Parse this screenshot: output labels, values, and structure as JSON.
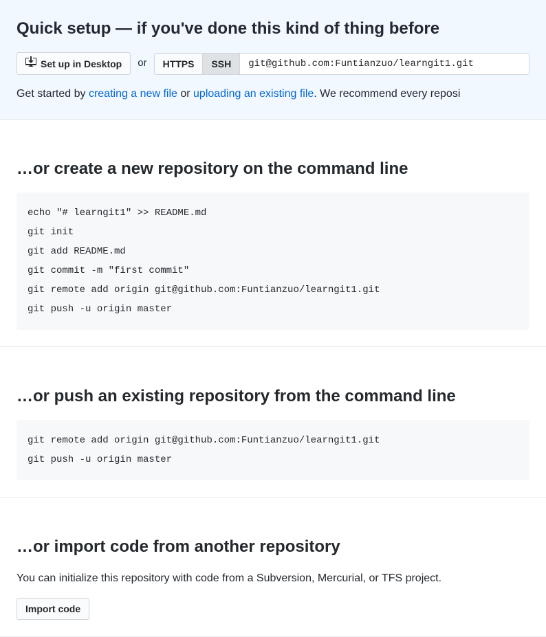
{
  "quick_setup": {
    "heading": "Quick setup — if you've done this kind of thing before",
    "desktop_button": "Set up in Desktop",
    "or": "or",
    "https_label": "HTTPS",
    "ssh_label": "SSH",
    "clone_url": "git@github.com:Funtianzuo/learngit1.git",
    "get_started_prefix": "Get started by ",
    "create_file_link": "creating a new file",
    "get_started_or": " or ",
    "upload_file_link": "uploading an existing file",
    "get_started_suffix": ". We recommend every reposi"
  },
  "create_section": {
    "heading": "…or create a new repository on the command line",
    "code": "echo \"# learngit1\" >> README.md\ngit init\ngit add README.md\ngit commit -m \"first commit\"\ngit remote add origin git@github.com:Funtianzuo/learngit1.git\ngit push -u origin master"
  },
  "push_section": {
    "heading": "…or push an existing repository from the command line",
    "code": "git remote add origin git@github.com:Funtianzuo/learngit1.git\ngit push -u origin master"
  },
  "import_section": {
    "heading": "…or import code from another repository",
    "description": "You can initialize this repository with code from a Subversion, Mercurial, or TFS project.",
    "button": "Import code"
  }
}
